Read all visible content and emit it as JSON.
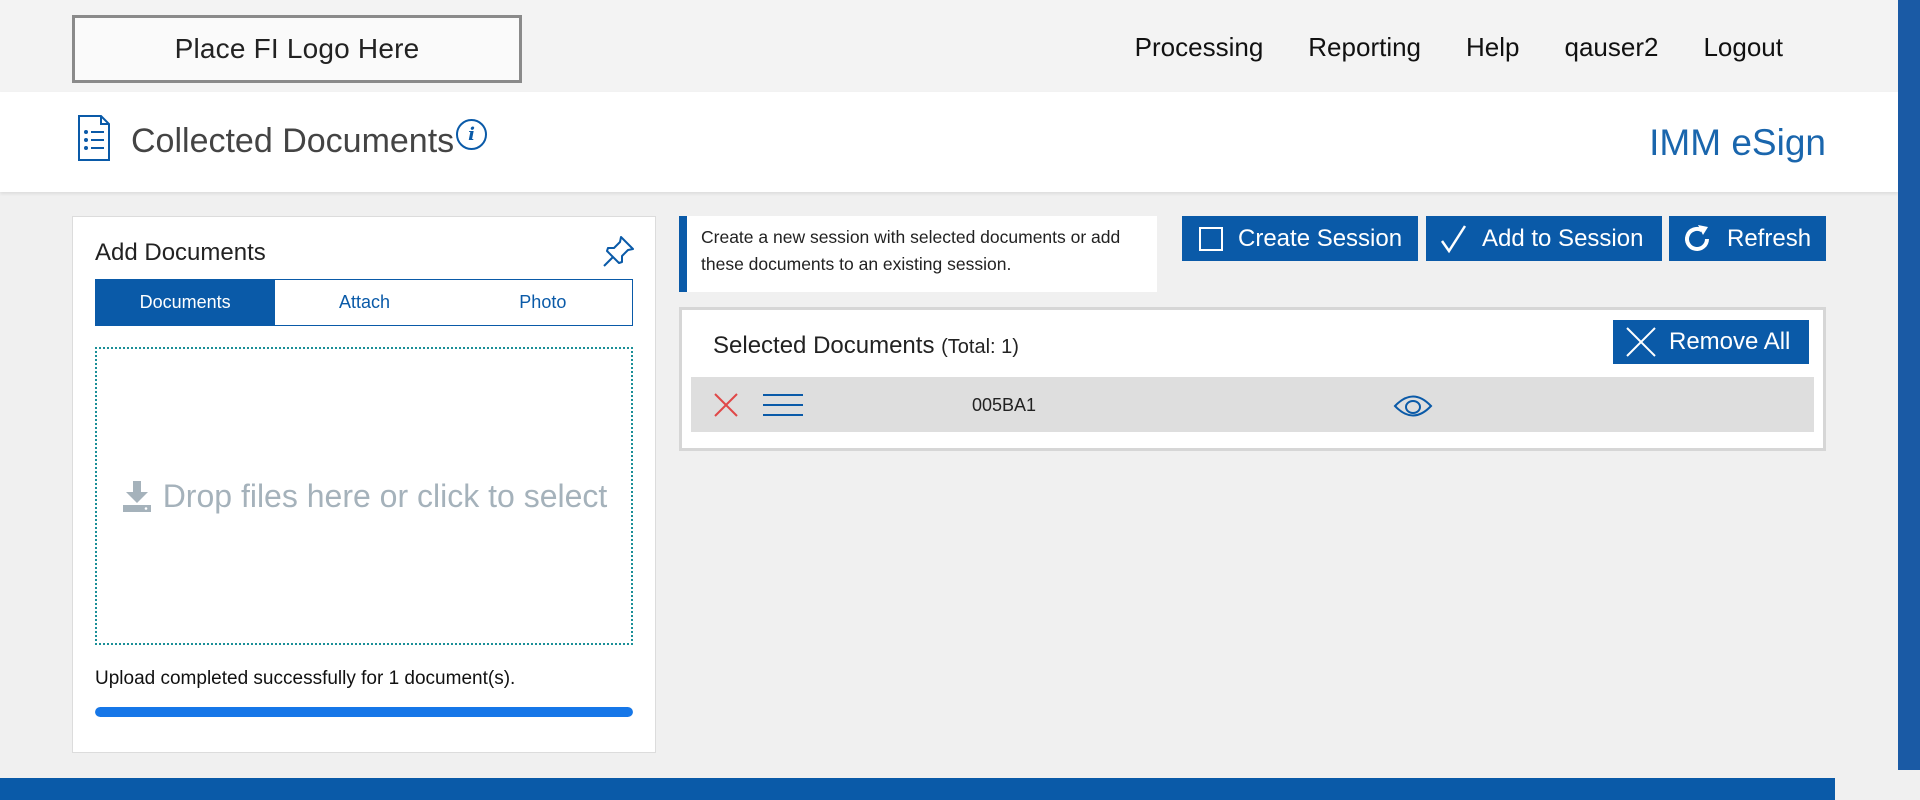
{
  "header": {
    "logo_text": "Place FI Logo Here",
    "nav": [
      "Processing",
      "Reporting",
      "Help",
      "qauser2",
      "Logout"
    ]
  },
  "page": {
    "title": "Collected Documents",
    "info_icon": "i",
    "brand": "IMM eSign"
  },
  "add_documents": {
    "title": "Add Documents",
    "tabs": [
      {
        "label": "Documents",
        "active": true
      },
      {
        "label": "Attach",
        "active": false
      },
      {
        "label": "Photo",
        "active": false
      }
    ],
    "dropzone_text": "Drop files here or click to select",
    "upload_message": "Upload completed successfully for 1 document(s).",
    "progress_percent": 100
  },
  "session": {
    "hint": "Create a new session with selected documents or add these documents to an existing session.",
    "create_label": "Create Session",
    "add_label": "Add to Session",
    "refresh_label": "Refresh"
  },
  "selected_documents": {
    "title": "Selected Documents",
    "total_text": "(Total: 1)",
    "remove_all_label": "Remove All",
    "rows": [
      {
        "name": "005BA1"
      }
    ]
  },
  "colors": {
    "primary": "#0a5aa8",
    "progress": "#1677e8",
    "remove_x": "#e04848",
    "dropzone_border": "#1a8f97"
  },
  "icons": [
    "document-list-icon",
    "info-icon",
    "pin-icon",
    "download-icon",
    "checkbox-icon",
    "checkmark-icon",
    "refresh-icon",
    "close-icon",
    "hamburger-icon",
    "eye-icon"
  ]
}
